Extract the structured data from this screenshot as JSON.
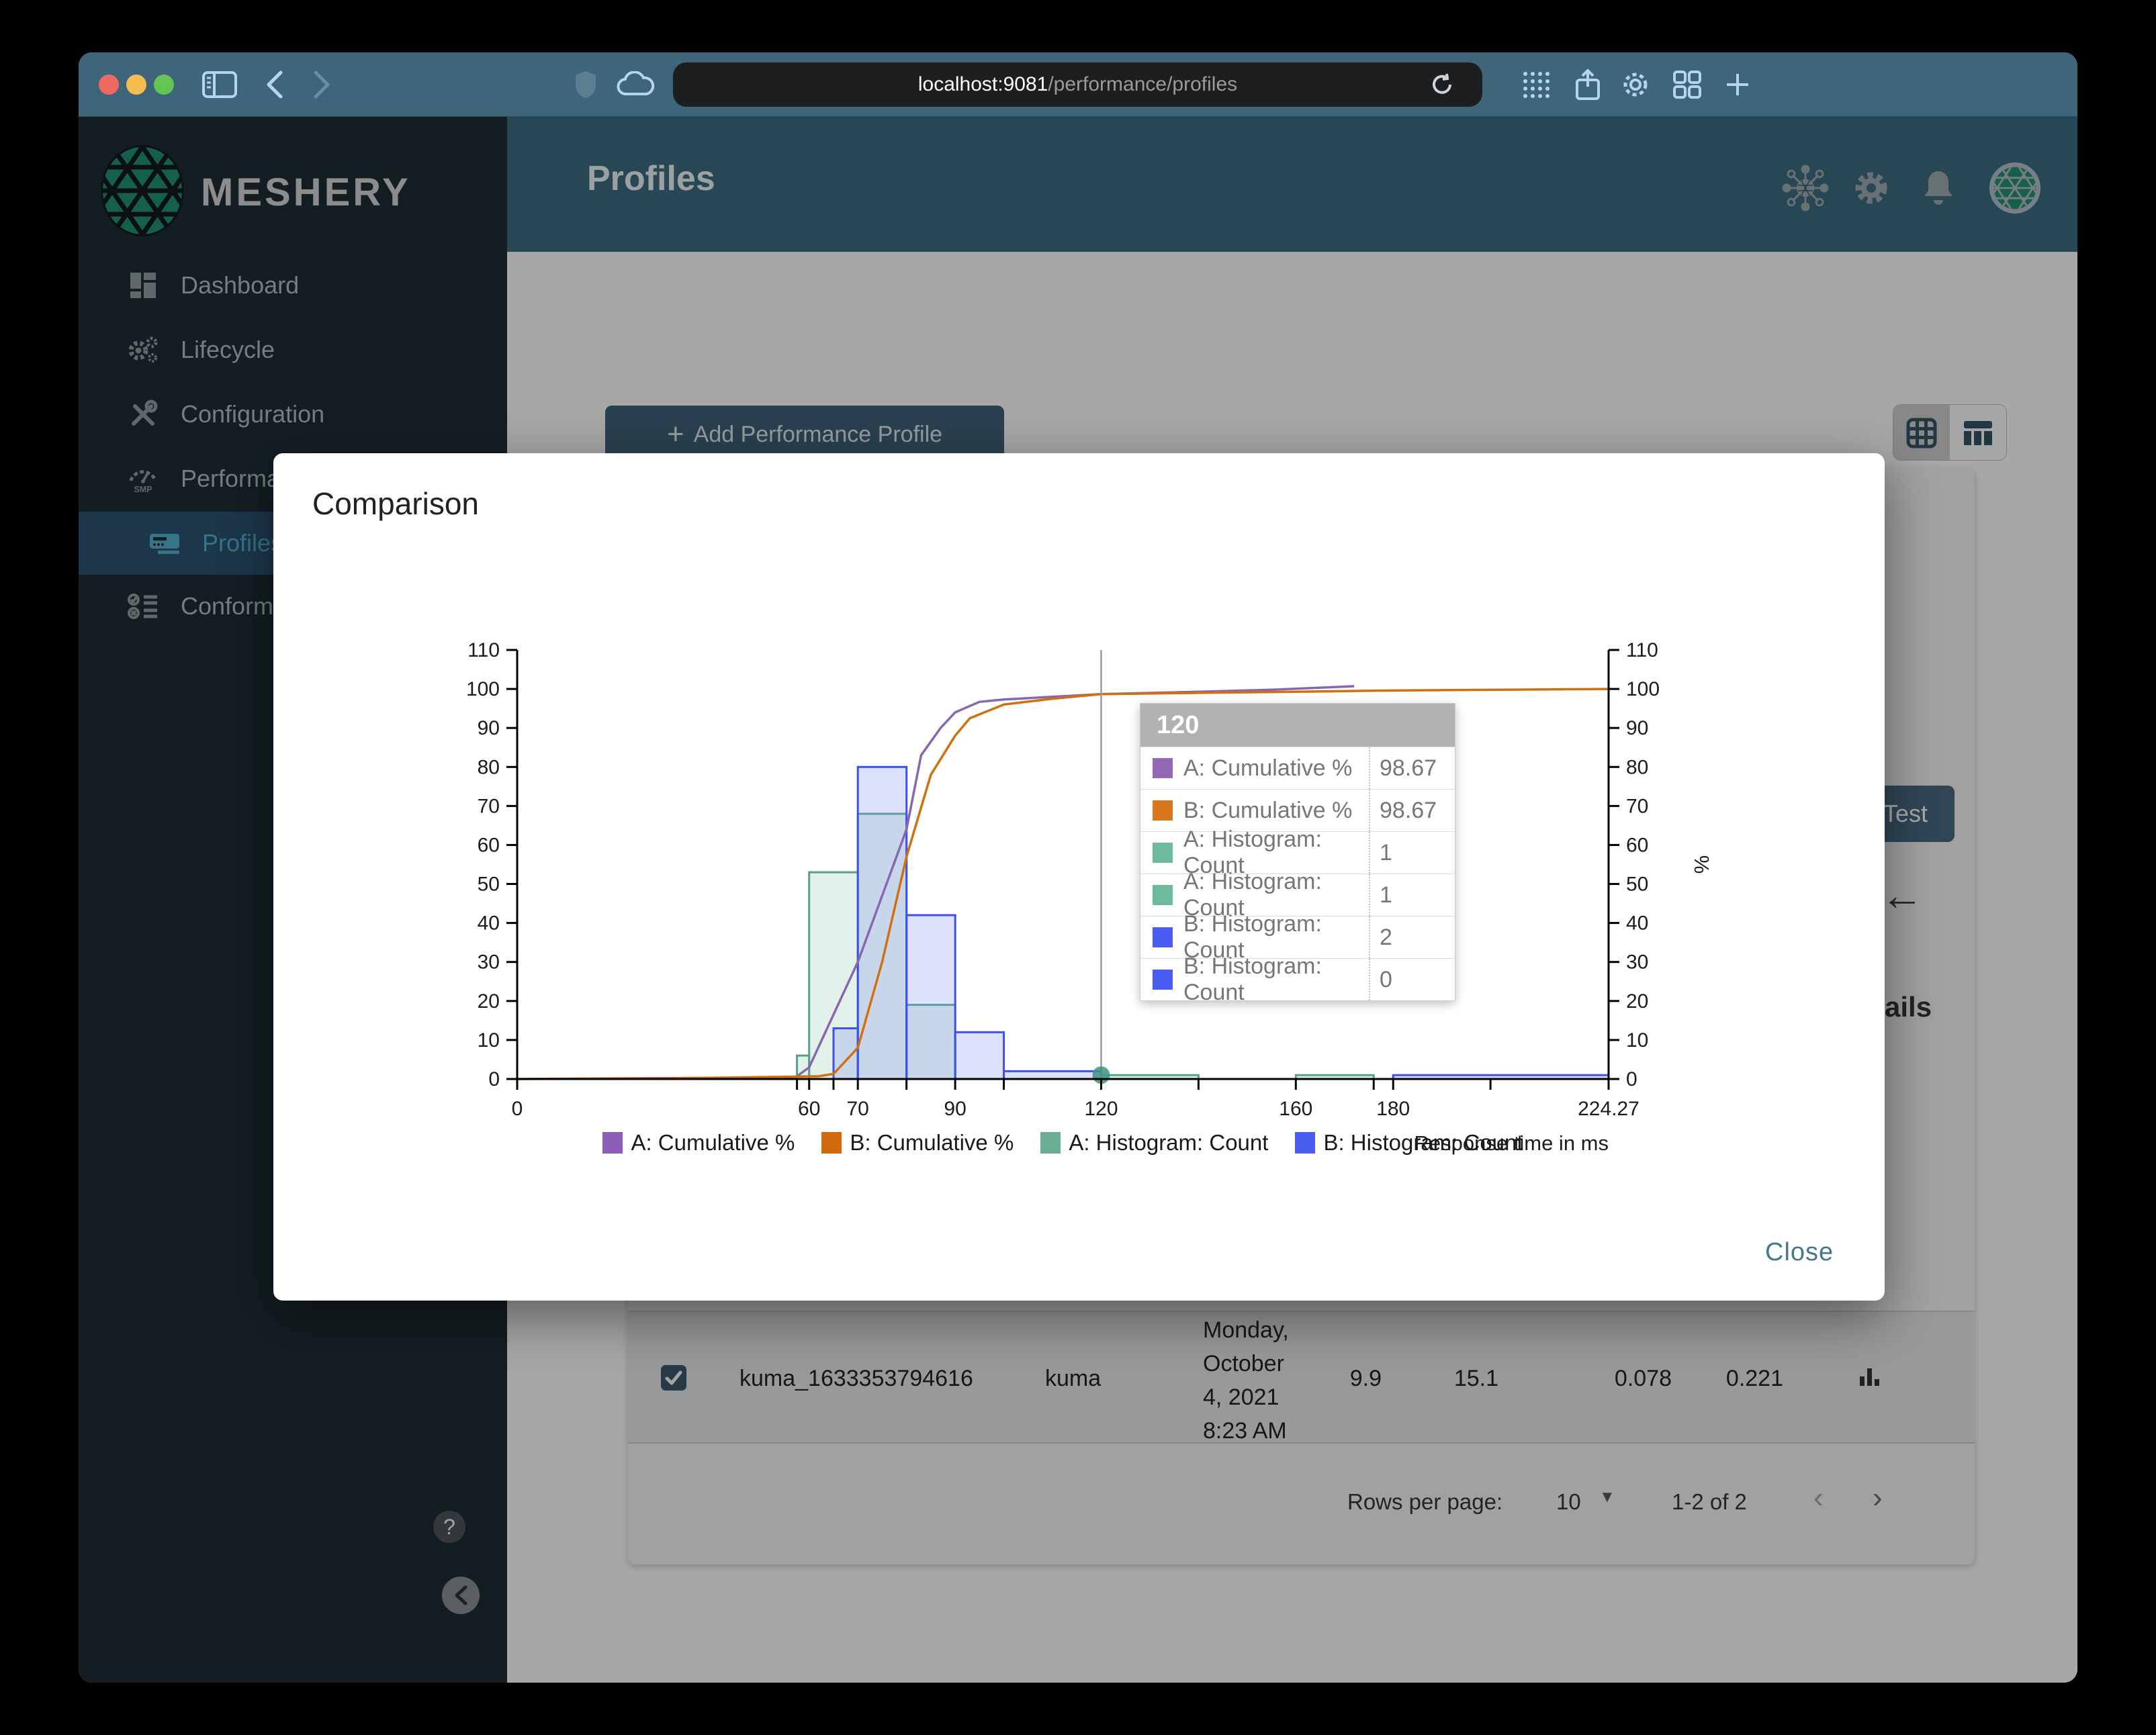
{
  "browser": {
    "url_host": "localhost:9081",
    "url_path": "/performance/profiles"
  },
  "brand": {
    "logo_text": "MESHERY"
  },
  "header": {
    "title": "Profiles"
  },
  "sidebar": {
    "items": [
      {
        "label": "Dashboard"
      },
      {
        "label": "Lifecycle"
      },
      {
        "label": "Configuration"
      },
      {
        "label": "Performance"
      },
      {
        "label": "Profiles"
      },
      {
        "label": "Conformance"
      }
    ],
    "help_glyph": "?"
  },
  "content": {
    "add_button": "Add Performance Profile",
    "test_button": "Test",
    "back_arrow": "←",
    "partial_heading": "ails",
    "table_row": {
      "name": "kuma_1633353794616",
      "mesh": "kuma",
      "date_lines": [
        "Monday,",
        "October",
        "4, 2021",
        "8:23 AM"
      ],
      "qps": "9.9",
      "duration": "15.1",
      "p50": "0.078",
      "p99": "0.221"
    },
    "pagination": {
      "rows_per_page_label": "Rows per page:",
      "rows_per_page_value": "10",
      "range": "1-2 of 2"
    }
  },
  "modal": {
    "title": "Comparison",
    "close_label": "Close"
  },
  "chart_data": {
    "type": "histogram+cumulative",
    "title": "Comparison",
    "xlabel": "Response time in ms",
    "ylabel_right": "%",
    "xlim": [
      0,
      224.27
    ],
    "ylim": [
      0,
      110
    ],
    "grid": false,
    "legend_position": "bottom",
    "y_ticks": [
      0,
      10,
      20,
      30,
      40,
      50,
      60,
      70,
      80,
      90,
      100,
      110
    ],
    "x_ticks": [
      {
        "v": 0,
        "label": "0"
      },
      {
        "v": 57.5
      },
      {
        "v": 60,
        "label": "60"
      },
      {
        "v": 65
      },
      {
        "v": 70,
        "label": "70"
      },
      {
        "v": 80
      },
      {
        "v": 90,
        "label": "90"
      },
      {
        "v": 100
      },
      {
        "v": 120,
        "label": "120"
      },
      {
        "v": 140
      },
      {
        "v": 160,
        "label": "160"
      },
      {
        "v": 176
      },
      {
        "v": 180,
        "label": "180"
      },
      {
        "v": 200
      },
      {
        "v": 224.27,
        "label": "224.27"
      }
    ],
    "bar_series": [
      {
        "name": "A: Histogram: Count",
        "stroke": "#57a18c",
        "fill": "rgba(125,190,160,0.22)",
        "bins": [
          [
            57.5,
            60,
            6
          ],
          [
            60,
            70,
            53
          ],
          [
            70,
            80,
            68
          ],
          [
            80,
            90,
            19
          ],
          [
            120,
            140,
            1
          ],
          [
            160,
            176,
            1
          ]
        ]
      },
      {
        "name": "B: Histogram: Count",
        "stroke": "#3c51ef",
        "fill": "rgba(125,135,245,0.25)",
        "bins": [
          [
            65,
            70,
            13
          ],
          [
            70,
            80,
            80
          ],
          [
            80,
            90,
            42
          ],
          [
            90,
            100,
            12
          ],
          [
            100,
            120,
            2
          ],
          [
            180,
            224.27,
            1
          ]
        ]
      }
    ],
    "line_series": [
      {
        "name": "A: Cumulative %",
        "color": "#8767af",
        "points": [
          [
            55,
            0
          ],
          [
            57.5,
            0.7
          ],
          [
            60,
            3
          ],
          [
            70,
            30
          ],
          [
            80,
            64
          ],
          [
            83,
            83
          ],
          [
            87,
            90
          ],
          [
            90,
            94
          ],
          [
            95,
            96.7
          ],
          [
            100,
            97.3
          ],
          [
            110,
            98
          ],
          [
            120,
            98.67
          ],
          [
            140,
            99.3
          ],
          [
            155,
            99.8
          ],
          [
            172,
            100.7
          ]
        ]
      },
      {
        "name": "B: Cumulative %",
        "color": "#d2700f",
        "points": [
          [
            0,
            0
          ],
          [
            40,
            0.3
          ],
          [
            62,
            0.7
          ],
          [
            65,
            1.3
          ],
          [
            70,
            8
          ],
          [
            75,
            30
          ],
          [
            80,
            57
          ],
          [
            85,
            78
          ],
          [
            90,
            88
          ],
          [
            93,
            92.5
          ],
          [
            100,
            96
          ],
          [
            110,
            97.5
          ],
          [
            120,
            98.67
          ],
          [
            140,
            99
          ],
          [
            160,
            99.3
          ],
          [
            180,
            99.6
          ],
          [
            224.27,
            100
          ]
        ]
      }
    ],
    "legend": [
      {
        "label": "A: Cumulative %",
        "color": "#8b5cb8"
      },
      {
        "label": "B: Cumulative %",
        "color": "#d2690e"
      },
      {
        "label": "A: Histogram: Count",
        "color": "#69ae92"
      },
      {
        "label": "B: Histogram: Count",
        "color": "#4a5df0"
      }
    ],
    "tooltip": {
      "header": "120",
      "rows": [
        {
          "label": "A: Cumulative %",
          "color": "#9368b5",
          "value": "98.67"
        },
        {
          "label": "B: Cumulative %",
          "color": "#d9771f",
          "value": "98.67"
        },
        {
          "label": "A: Histogram: Count",
          "color": "#6cba9b",
          "value": "1"
        },
        {
          "label": "A: Histogram: Count",
          "color": "#6cba9b",
          "value": "1"
        },
        {
          "label": "B: Histogram: Count",
          "color": "#4a5bf2",
          "value": "2"
        },
        {
          "label": "B: Histogram: Count",
          "color": "#4a5bf2",
          "value": "0"
        }
      ]
    },
    "focus": {
      "x": 120,
      "point_value": 1,
      "point_color": "#3f9383",
      "line_color": "#9b9b9b"
    }
  }
}
